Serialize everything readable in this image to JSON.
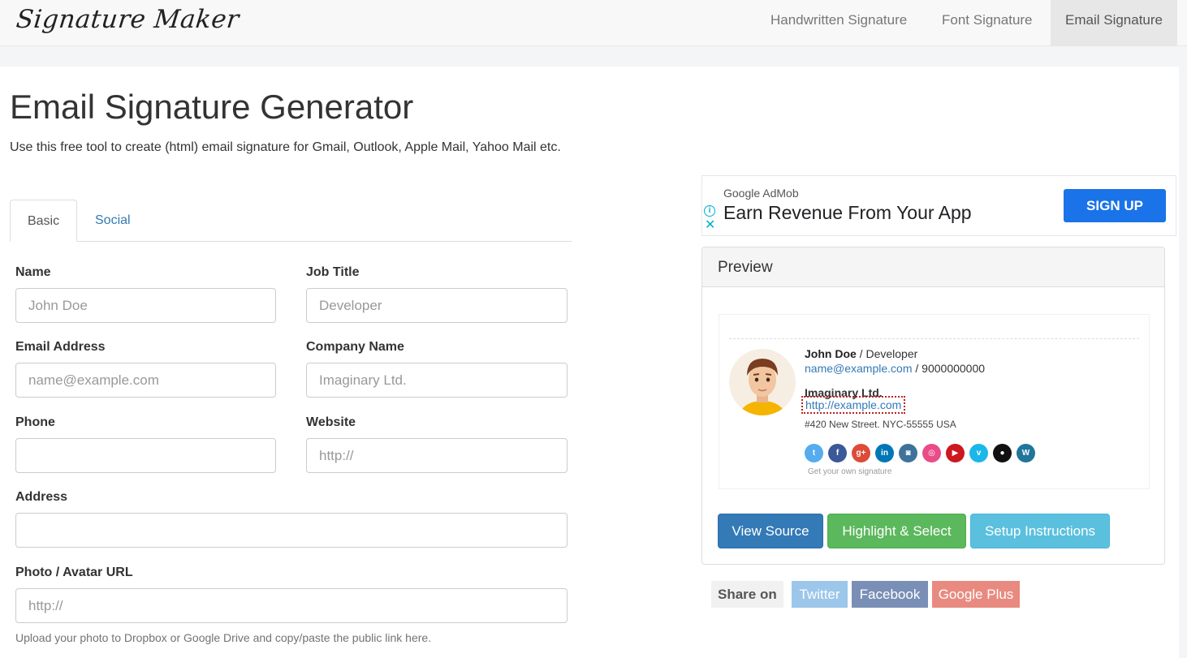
{
  "navbar": {
    "brand": "Signature Maker",
    "links": [
      {
        "label": "Handwritten Signature"
      },
      {
        "label": "Font Signature"
      },
      {
        "label": "Email Signature",
        "active": true
      }
    ]
  },
  "header": {
    "title": "Email Signature Generator",
    "lead": "Use this free tool to create (html) email signature for Gmail, Outlook, Apple Mail, Yahoo Mail etc."
  },
  "tabs": [
    {
      "label": "Basic",
      "active": true
    },
    {
      "label": "Social"
    }
  ],
  "form": {
    "name": {
      "label": "Name",
      "placeholder": "John Doe"
    },
    "job_title": {
      "label": "Job Title",
      "placeholder": "Developer"
    },
    "email": {
      "label": "Email Address",
      "placeholder": "name@example.com"
    },
    "company": {
      "label": "Company Name",
      "placeholder": "Imaginary Ltd."
    },
    "phone": {
      "label": "Phone",
      "placeholder": ""
    },
    "website": {
      "label": "Website",
      "placeholder": "http://"
    },
    "address": {
      "label": "Address",
      "placeholder": ""
    },
    "photo": {
      "label": "Photo / Avatar URL",
      "placeholder": "http://"
    },
    "photo_help": "Upload your photo to Dropbox or Google Drive and copy/paste the public link here."
  },
  "ad": {
    "brand": "Google AdMob",
    "headline": "Earn Revenue From Your App",
    "cta": "SIGN UP",
    "info_icon": "i",
    "close_icon": "✕"
  },
  "preview": {
    "title": "Preview",
    "signature": {
      "name": "John Doe",
      "separator": " / ",
      "job_title": "Developer",
      "email": "name@example.com",
      "phone": "9000000000",
      "company": "Imaginary Ltd.",
      "website": "http://example.com",
      "address": "#420 New Street. NYC-55555 USA",
      "footer": "Get your own signature"
    },
    "social_icons": [
      {
        "name": "twitter",
        "glyph": "t",
        "color": "#55acee"
      },
      {
        "name": "facebook",
        "glyph": "f",
        "color": "#3b5998"
      },
      {
        "name": "google-plus",
        "glyph": "g+",
        "color": "#dd4b39"
      },
      {
        "name": "linkedin",
        "glyph": "in",
        "color": "#0077b5"
      },
      {
        "name": "instagram",
        "glyph": "◙",
        "color": "#3f729b"
      },
      {
        "name": "dribbble",
        "glyph": "◎",
        "color": "#ea4c89"
      },
      {
        "name": "youtube",
        "glyph": "▶",
        "color": "#cc181e"
      },
      {
        "name": "vimeo",
        "glyph": "v",
        "color": "#1ab7ea"
      },
      {
        "name": "github",
        "glyph": "●",
        "color": "#111111"
      },
      {
        "name": "wordpress",
        "glyph": "W",
        "color": "#21759b"
      }
    ],
    "buttons": {
      "view_source": "View Source",
      "highlight": "Highlight & Select",
      "setup": "Setup Instructions"
    }
  },
  "share": {
    "label": "Share on",
    "buttons": [
      {
        "label": "Twitter",
        "color": "#9cc6ea"
      },
      {
        "label": "Facebook",
        "color": "#7a8fb6"
      },
      {
        "label": "Google Plus",
        "color": "#e98a80"
      }
    ]
  }
}
